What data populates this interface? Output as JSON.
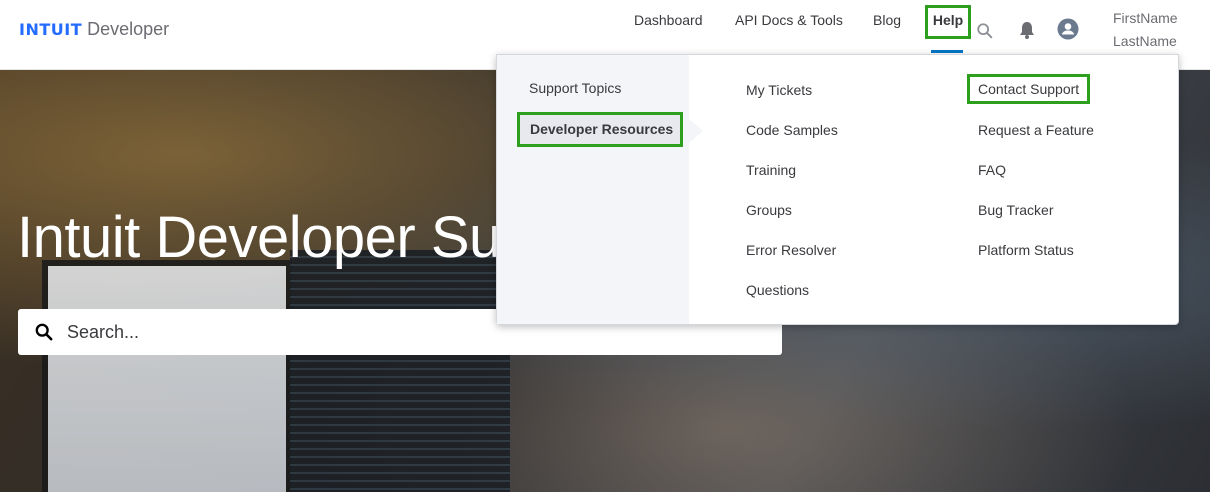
{
  "header": {
    "logo_brand": "INTUIT",
    "logo_sub": "Developer",
    "nav": {
      "dashboard": "Dashboard",
      "api": "API Docs & Tools",
      "blog": "Blog",
      "help": "Help"
    },
    "user": {
      "first": "FirstName",
      "last": "LastName"
    }
  },
  "hero": {
    "title": "Intuit Developer Su",
    "search_placeholder": "Search..."
  },
  "dropdown": {
    "left": {
      "topics": "Support Topics",
      "resources": "Developer Resources"
    },
    "col1": [
      "My Tickets",
      "Code Samples",
      "Training",
      "Groups",
      "Error Resolver",
      "Questions"
    ],
    "col2": [
      "Contact Support",
      "Request a Feature",
      "FAQ",
      "Bug Tracker",
      "Platform Status"
    ]
  },
  "colors": {
    "accent": "#2ca01c",
    "brand": "#236cff",
    "underline": "#0077c5"
  },
  "icons": [
    "search-icon",
    "bell-icon",
    "user-icon"
  ]
}
